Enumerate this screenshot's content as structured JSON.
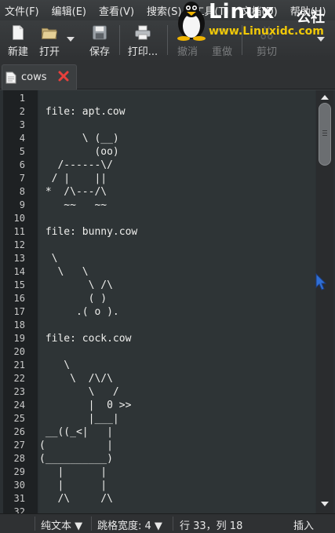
{
  "menu": [
    "文件(F)",
    "编辑(E)",
    "查看(V)",
    "搜索(S)",
    "工具(T)",
    "文档(D)",
    "帮助(H)"
  ],
  "toolbar": {
    "new_label": "新建",
    "open_label": "打开",
    "save_label": "保存",
    "print_label": "打印...",
    "undo_label": "撤消",
    "redo_label": "重做",
    "cut_label": "剪切"
  },
  "logo": {
    "text": "Linux",
    "cn": "公社",
    "url": "www.Linuxidc.com"
  },
  "tab": {
    "label": "cows"
  },
  "editor": {
    "line_numbers": [
      "1",
      "2",
      "3",
      "4",
      "5",
      "6",
      "7",
      "8",
      "9",
      "10",
      "11",
      "12",
      "13",
      "14",
      "15",
      "16",
      "17",
      "18",
      "19",
      "20",
      "21",
      "22",
      "23",
      "24",
      "25",
      "26",
      "27",
      "28",
      "29",
      "30",
      "31",
      "32"
    ],
    "lines": [
      "",
      " file: apt.cow",
      "",
      "       \\ (__)",
      "         (oo)",
      "   /------\\/",
      "  / |    ||",
      " *  /\\---/\\",
      "    ~~   ~~",
      "",
      " file: bunny.cow",
      "",
      "  \\",
      "   \\   \\",
      "        \\ /\\",
      "        ( )",
      "      .( o ).",
      "",
      " file: cock.cow",
      "",
      "    \\",
      "     \\  /\\/\\",
      "        \\   /",
      "        |  0 >>",
      "        |___|",
      " __((_<|   |",
      "(          |",
      "(__________)",
      "   |      |",
      "   |      |",
      "   /\\     /\\",
      ""
    ]
  },
  "status": {
    "filetype": "纯文本 ▼",
    "tab_width": "跳格宽度: 4 ▼",
    "position": "行 33，列 18",
    "mode": "插入"
  }
}
